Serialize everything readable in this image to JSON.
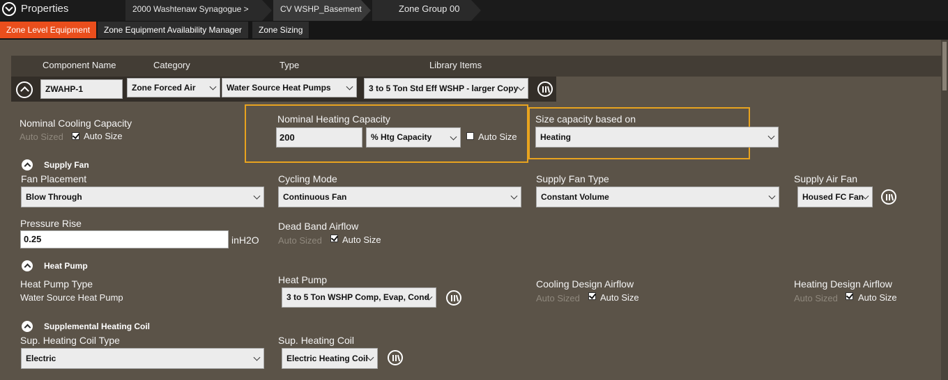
{
  "header": {
    "title": "Properties",
    "breadcrumbs": [
      "2000 Washtenaw Synagogue >",
      "CV WSHP_Basement",
      "Zone Group 00"
    ]
  },
  "tabs": [
    "Zone Level Equipment",
    "Zone Equipment Availability Manager",
    "Zone Sizing"
  ],
  "component_table": {
    "headers": {
      "name": "Component Name",
      "category": "Category",
      "type": "Type",
      "library": "Library Items"
    },
    "name_value": "ZWAHP-1",
    "category_value": "Zone Forced Air",
    "type_value": "Water Source Heat Pumps",
    "library_value": "3 to 5 Ton Std Eff WSHP - larger Copy"
  },
  "capacity": {
    "cooling_label": "Nominal Cooling Capacity",
    "cooling_value": "Auto Sized",
    "cooling_autosize_label": "Auto Size",
    "heating_label": "Nominal Heating Capacity",
    "heating_value": "200",
    "heating_unit": "% Htg Capacity",
    "heating_autosize_label": "Auto Size",
    "size_based_label": "Size capacity based on",
    "size_based_value": "Heating"
  },
  "supply_fan": {
    "section_title": "Supply Fan",
    "placement_label": "Fan Placement",
    "placement_value": "Blow Through",
    "cycling_label": "Cycling Mode",
    "cycling_value": "Continuous Fan",
    "type_label": "Supply Fan Type",
    "type_value": "Constant Volume",
    "fan_label": "Supply Air Fan",
    "fan_value": "Housed FC Fan",
    "pressure_label": "Pressure Rise",
    "pressure_value": "0.25",
    "pressure_unit": "inH2O",
    "deadband_label": "Dead Band Airflow",
    "deadband_value": "Auto Sized",
    "deadband_autosize_label": "Auto Size"
  },
  "heat_pump": {
    "section_title": "Heat Pump",
    "type_label": "Heat Pump Type",
    "type_value": "Water Source Heat Pump",
    "pump_label": "Heat Pump",
    "pump_value": "3 to 5 Ton WSHP Comp, Evap, Cond",
    "cooling_airflow_label": "Cooling Design Airflow",
    "cooling_airflow_value": "Auto Sized",
    "cooling_airflow_autosize_label": "Auto Size",
    "heating_airflow_label": "Heating Design Airflow",
    "heating_airflow_value": "Auto Sized",
    "heating_airflow_autosize_label": "Auto Size"
  },
  "supplemental": {
    "section_title": "Supplemental Heating Coil",
    "coil_type_label": "Sup. Heating Coil Type",
    "coil_type_value": "Electric",
    "coil_label": "Sup. Heating Coil",
    "coil_value": "Electric Heating Coil"
  },
  "colors": {
    "accent_tab": "#ea4e1c",
    "highlight": "#e8a31f",
    "background": "#5b5348"
  }
}
